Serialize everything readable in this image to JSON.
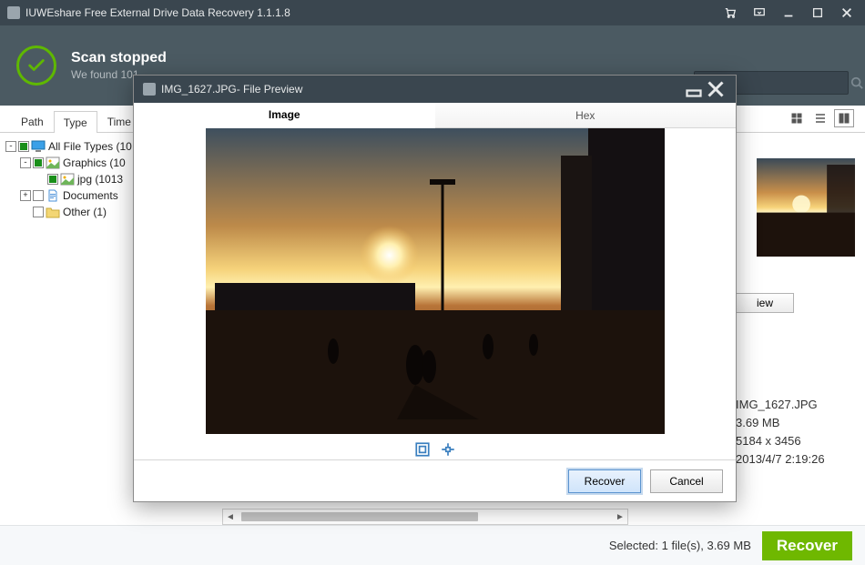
{
  "app": {
    "title": "IUWEshare Free External Drive Data Recovery 1.1.1.8"
  },
  "status": {
    "heading": "Scan stopped",
    "sub": "We found 101"
  },
  "search": {
    "placeholder": "Search"
  },
  "tabs": {
    "path": "Path",
    "type": "Type",
    "time": "Time"
  },
  "tree": {
    "root": "All File Types (10",
    "graphics": "Graphics (10",
    "jpg": "jpg (1013",
    "documents": "Documents",
    "other": "Other (1)"
  },
  "preview": {
    "window_title": "IMG_1627.JPG- File Preview",
    "tab_image": "Image",
    "tab_hex": "Hex",
    "recover": "Recover",
    "cancel": "Cancel"
  },
  "side_panel": {
    "button_fragment": "iew",
    "lines": {
      "name": "IMG_1627.JPG",
      "size": "3.69 MB",
      "dims": "5184 x 3456",
      "date": "2013/4/7 2:19:26"
    }
  },
  "footer": {
    "selected": "Selected: 1 file(s), 3.69 MB",
    "recover": "Recover"
  }
}
